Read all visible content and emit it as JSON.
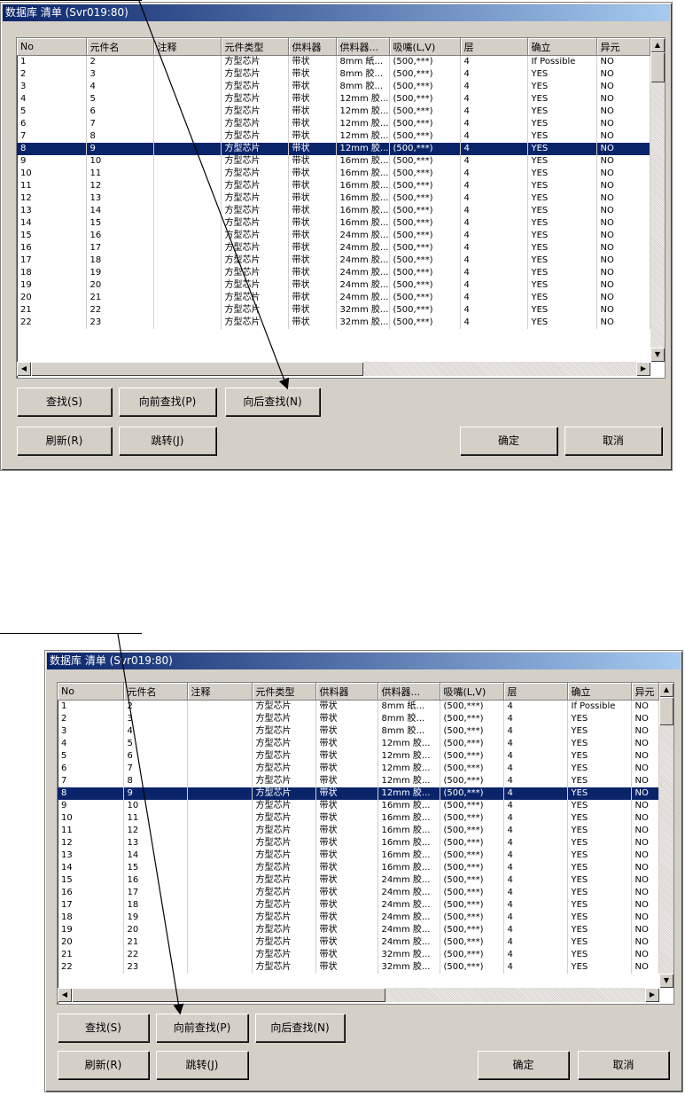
{
  "dialog_title": "数据库 清单 (Svr019:80)",
  "columns": [
    "No",
    "元件名",
    "注释",
    "元件类型",
    "供料器",
    "供料器...",
    "吸嘴(L,V)",
    "层",
    "确立",
    "异元"
  ],
  "rows": [
    [
      "1",
      "2",
      "",
      "方型芯片",
      "带状",
      "8mm 紙...",
      "(500,***)",
      "4",
      "If Possible",
      "NO"
    ],
    [
      "2",
      "3",
      "",
      "方型芯片",
      "带状",
      "8mm 胶...",
      "(500,***)",
      "4",
      "YES",
      "NO"
    ],
    [
      "3",
      "4",
      "",
      "方型芯片",
      "带状",
      "8mm 胶...",
      "(500,***)",
      "4",
      "YES",
      "NO"
    ],
    [
      "4",
      "5",
      "",
      "方型芯片",
      "带状",
      "12mm 胶...",
      "(500,***)",
      "4",
      "YES",
      "NO"
    ],
    [
      "5",
      "6",
      "",
      "方型芯片",
      "带状",
      "12mm 胶...",
      "(500,***)",
      "4",
      "YES",
      "NO"
    ],
    [
      "6",
      "7",
      "",
      "方型芯片",
      "带状",
      "12mm 胶...",
      "(500,***)",
      "4",
      "YES",
      "NO"
    ],
    [
      "7",
      "8",
      "",
      "方型芯片",
      "带状",
      "12mm 胶...",
      "(500,***)",
      "4",
      "YES",
      "NO"
    ],
    [
      "8",
      "9",
      "",
      "方型芯片",
      "带状",
      "12mm 胶...",
      "(500,***)",
      "4",
      "YES",
      "NO"
    ],
    [
      "9",
      "10",
      "",
      "方型芯片",
      "带状",
      "16mm 胶...",
      "(500,***)",
      "4",
      "YES",
      "NO"
    ],
    [
      "10",
      "11",
      "",
      "方型芯片",
      "带状",
      "16mm 胶...",
      "(500,***)",
      "4",
      "YES",
      "NO"
    ],
    [
      "11",
      "12",
      "",
      "方型芯片",
      "带状",
      "16mm 胶...",
      "(500,***)",
      "4",
      "YES",
      "NO"
    ],
    [
      "12",
      "13",
      "",
      "方型芯片",
      "带状",
      "16mm 胶...",
      "(500,***)",
      "4",
      "YES",
      "NO"
    ],
    [
      "13",
      "14",
      "",
      "方型芯片",
      "带状",
      "16mm 胶...",
      "(500,***)",
      "4",
      "YES",
      "NO"
    ],
    [
      "14",
      "15",
      "",
      "方型芯片",
      "带状",
      "16mm 胶...",
      "(500,***)",
      "4",
      "YES",
      "NO"
    ],
    [
      "15",
      "16",
      "",
      "方型芯片",
      "带状",
      "24mm 胶...",
      "(500,***)",
      "4",
      "YES",
      "NO"
    ],
    [
      "16",
      "17",
      "",
      "方型芯片",
      "带状",
      "24mm 胶...",
      "(500,***)",
      "4",
      "YES",
      "NO"
    ],
    [
      "17",
      "18",
      "",
      "方型芯片",
      "带状",
      "24mm 胶...",
      "(500,***)",
      "4",
      "YES",
      "NO"
    ],
    [
      "18",
      "19",
      "",
      "方型芯片",
      "带状",
      "24mm 胶...",
      "(500,***)",
      "4",
      "YES",
      "NO"
    ],
    [
      "19",
      "20",
      "",
      "方型芯片",
      "带状",
      "24mm 胶...",
      "(500,***)",
      "4",
      "YES",
      "NO"
    ],
    [
      "20",
      "21",
      "",
      "方型芯片",
      "带状",
      "24mm 胶...",
      "(500,***)",
      "4",
      "YES",
      "NO"
    ],
    [
      "21",
      "22",
      "",
      "方型芯片",
      "带状",
      "32mm 胶...",
      "(500,***)",
      "4",
      "YES",
      "NO"
    ],
    [
      "22",
      "23",
      "",
      "方型芯片",
      "带状",
      "32mm 胶...",
      "(500,***)",
      "4",
      "YES",
      "NO"
    ]
  ],
  "selected_row_index": 7,
  "buttons": {
    "find": "查找(S)",
    "find_prev": "向前查找(P)",
    "find_next": "向后查找(N)",
    "refresh": "刷新(R)",
    "jump": "跳转(J)",
    "ok": "确定",
    "cancel": "取消"
  },
  "colors": {
    "dialog_bg": "#d4d0c8",
    "title_start": "#0a246a",
    "title_end": "#a6caf0",
    "selection": "#0a246a"
  }
}
